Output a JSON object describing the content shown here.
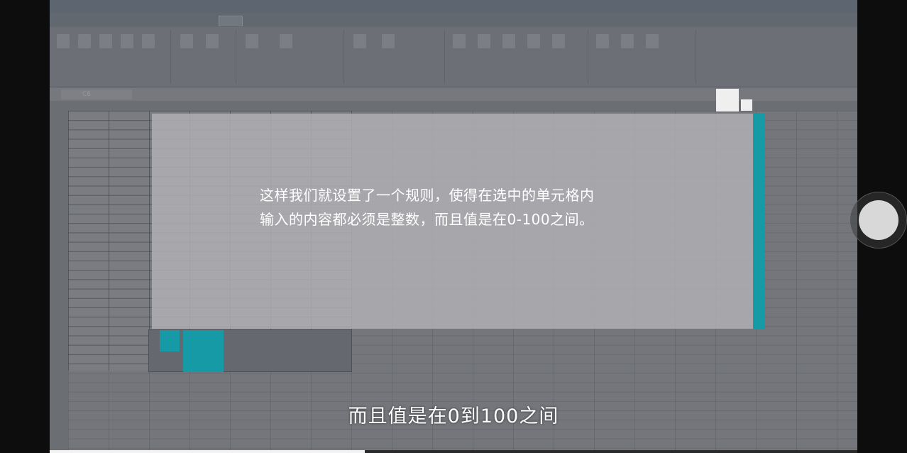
{
  "video": {
    "overlay_lines": [
      "这样我们就设置了一个规则，使得在选中的单元格内",
      "输入的内容都必须是整数，而且值是在0-100之间。"
    ],
    "subtitle": "而且值是在0到100之间",
    "progress": 0.39,
    "accent_color": "#169ba6"
  },
  "excel_background": {
    "window_title": "",
    "tabs": [
      "",
      "",
      "",
      "",
      "",
      "",
      ""
    ],
    "name_box": "C6"
  },
  "controls": {
    "floating_button_icon": "assistive-touch-icon"
  }
}
